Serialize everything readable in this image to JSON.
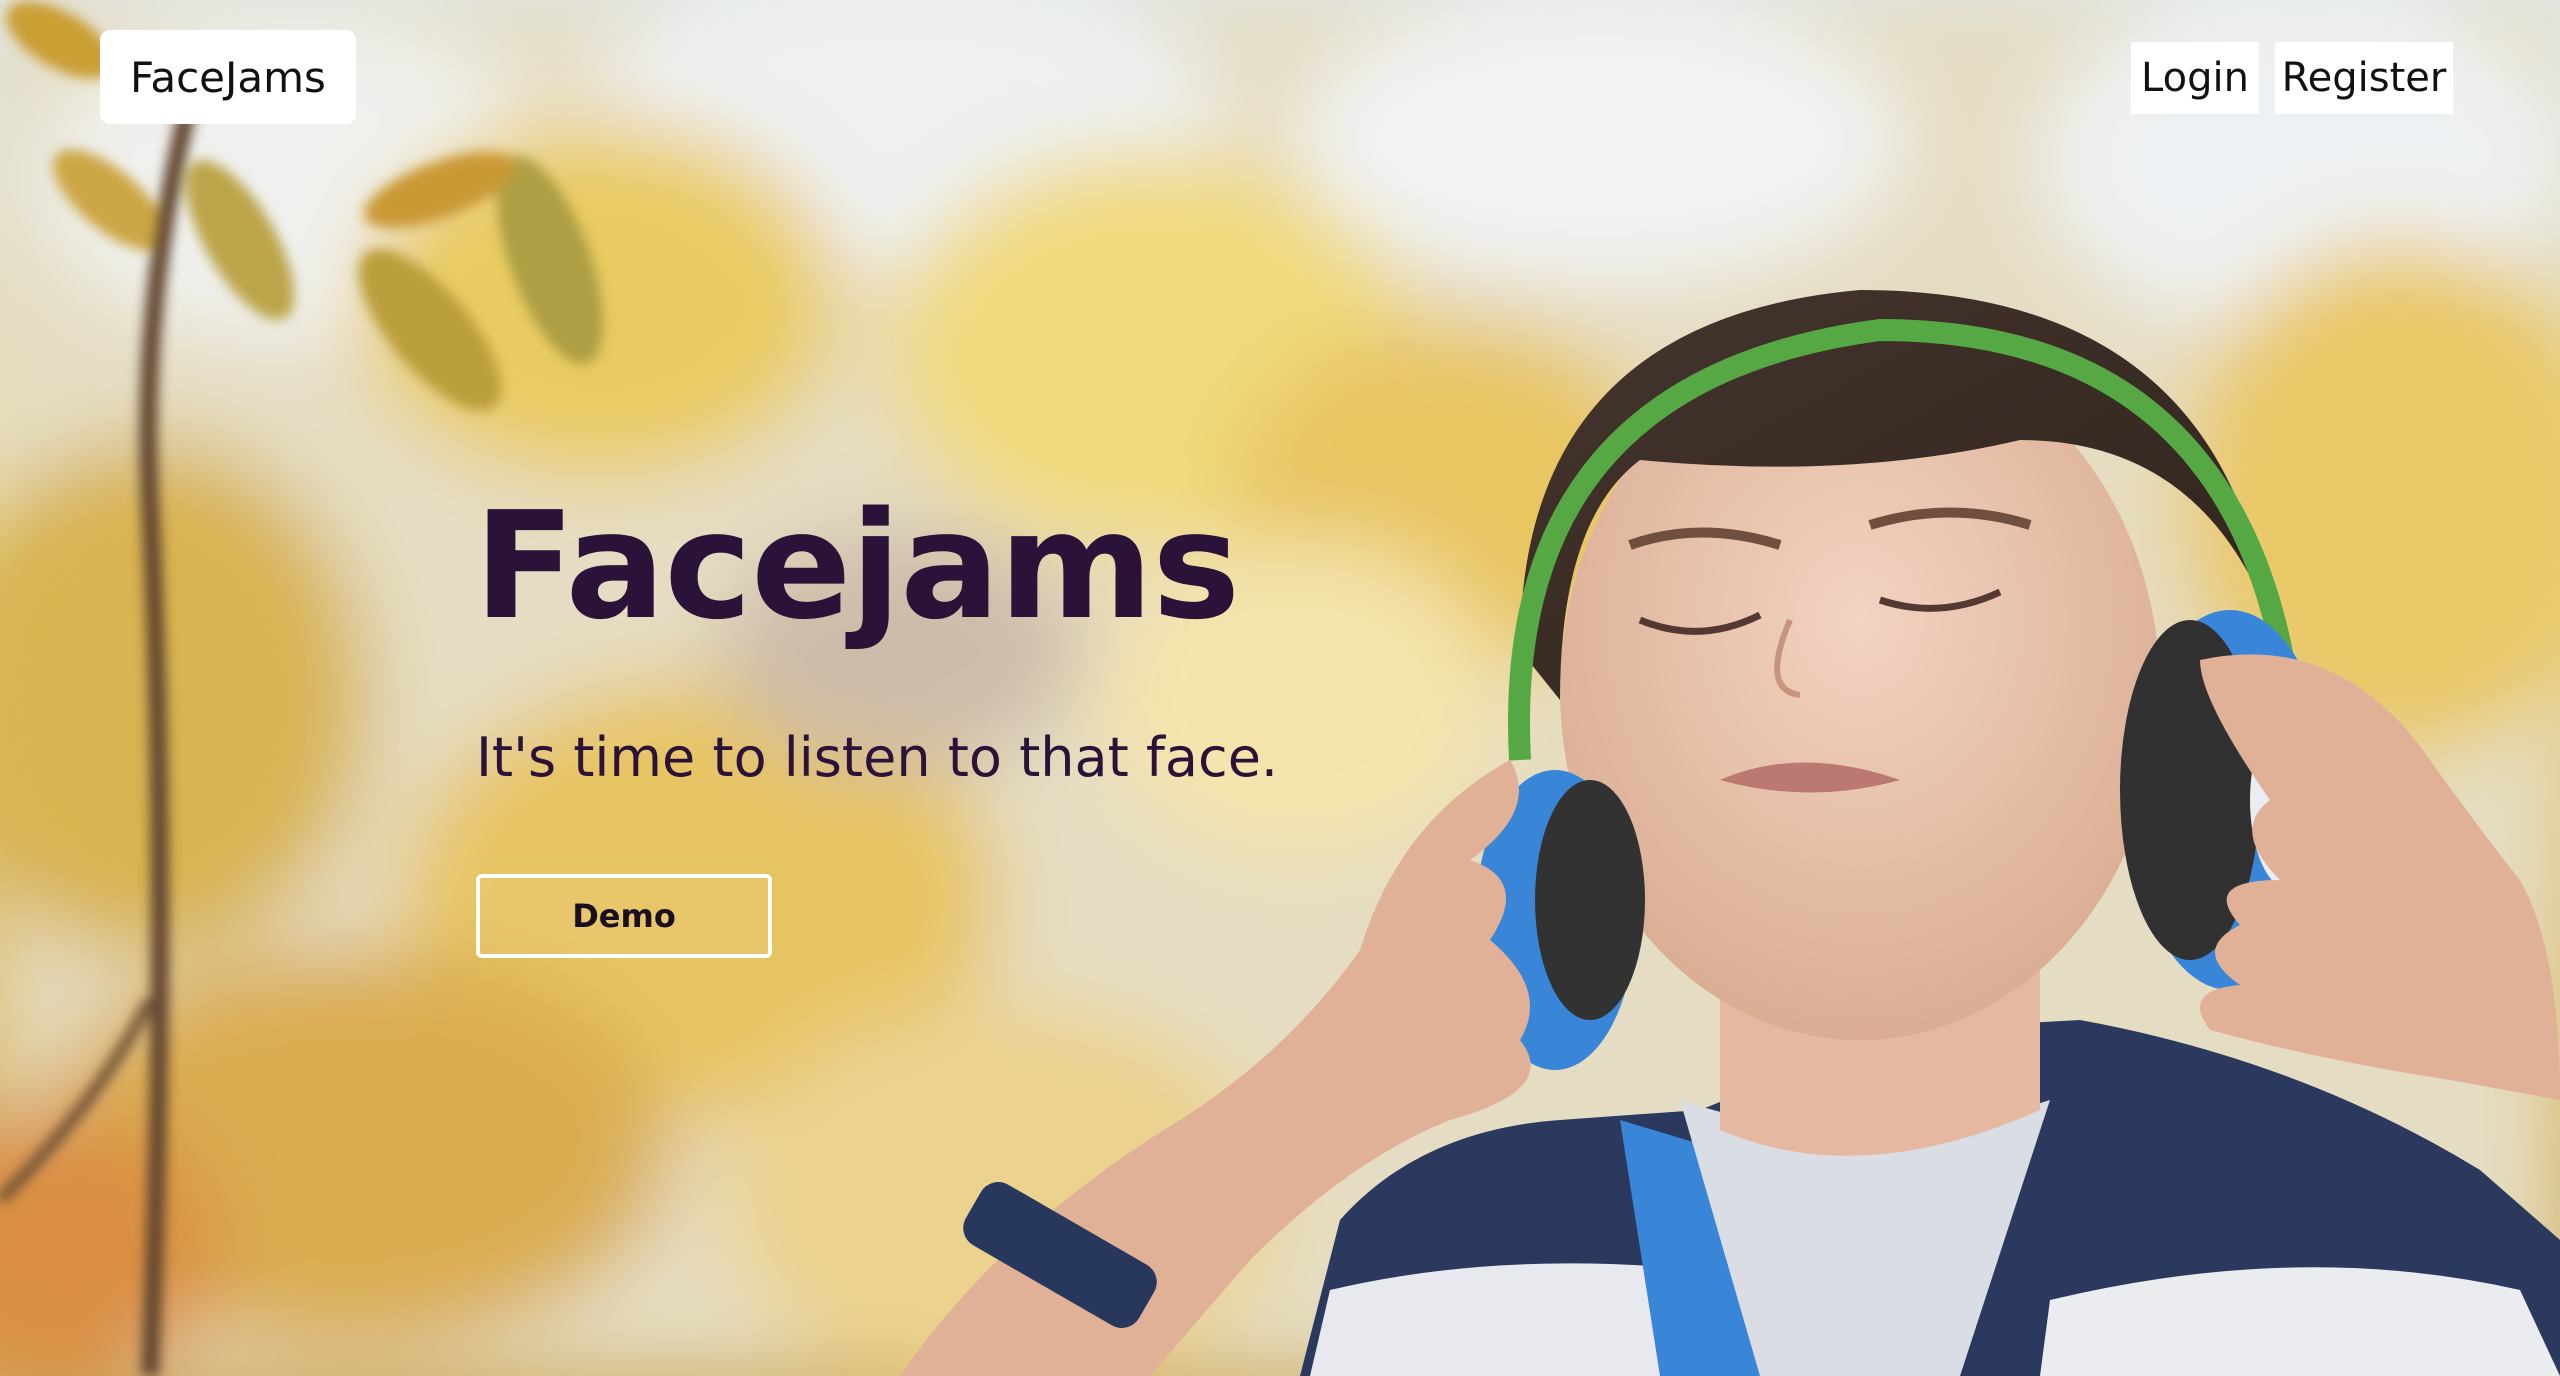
{
  "nav": {
    "brand_label": "FaceJams",
    "login_label": "Login",
    "register_label": "Register"
  },
  "hero": {
    "title": "Facejams",
    "subtitle": "It's time to listen to that face.",
    "demo_label": "Demo"
  },
  "colors": {
    "title_text": "#2a1238",
    "nav_background": "#ffffff",
    "headphone_blue": "#2f7fd6"
  }
}
